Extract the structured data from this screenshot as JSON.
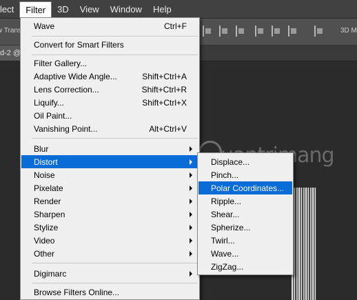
{
  "menubar": {
    "items": [
      "lect",
      "Filter",
      "3D",
      "View",
      "Window",
      "Help"
    ],
    "active_index": 1
  },
  "options_bar": {
    "left_text": "w Trans",
    "right_text": "3D M"
  },
  "tab": {
    "label": "d-2 @"
  },
  "watermark": {
    "text": "uantrimang"
  },
  "filter_menu": {
    "items": [
      {
        "label": "Wave",
        "shortcut": "Ctrl+F"
      },
      {
        "label": "Convert for Smart Filters",
        "shortcut": ""
      },
      {
        "label": "Filter Gallery...",
        "shortcut": ""
      },
      {
        "label": "Adaptive Wide Angle...",
        "shortcut": "Shift+Ctrl+A"
      },
      {
        "label": "Lens Correction...",
        "shortcut": "Shift+Ctrl+R"
      },
      {
        "label": "Liquify...",
        "shortcut": "Shift+Ctrl+X"
      },
      {
        "label": "Oil Paint...",
        "shortcut": ""
      },
      {
        "label": "Vanishing Point...",
        "shortcut": "Alt+Ctrl+V"
      },
      {
        "label": "Blur",
        "shortcut": ""
      },
      {
        "label": "Distort",
        "shortcut": ""
      },
      {
        "label": "Noise",
        "shortcut": ""
      },
      {
        "label": "Pixelate",
        "shortcut": ""
      },
      {
        "label": "Render",
        "shortcut": ""
      },
      {
        "label": "Sharpen",
        "shortcut": ""
      },
      {
        "label": "Stylize",
        "shortcut": ""
      },
      {
        "label": "Video",
        "shortcut": ""
      },
      {
        "label": "Other",
        "shortcut": ""
      },
      {
        "label": "Digimarc",
        "shortcut": ""
      },
      {
        "label": "Browse Filters Online...",
        "shortcut": ""
      }
    ],
    "highlighted": "Distort"
  },
  "distort_submenu": {
    "items": [
      "Displace...",
      "Pinch...",
      "Polar Coordinates...",
      "Ripple...",
      "Shear...",
      "Spherize...",
      "Twirl...",
      "Wave...",
      "ZigZag..."
    ],
    "highlighted": "Polar Coordinates..."
  },
  "colors": {
    "highlight": "#0a6cd6",
    "menu_bg": "#f0f0f0",
    "chrome": "#414141"
  }
}
